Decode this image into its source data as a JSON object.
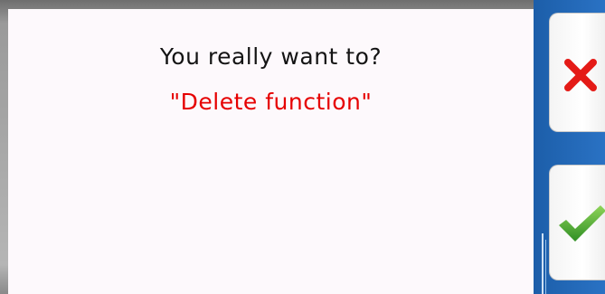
{
  "dialog": {
    "question": "You really want to?",
    "subject": "\"Delete function\""
  },
  "buttons": {
    "cancel_icon": "cross-icon",
    "confirm_icon": "checkmark-icon"
  },
  "colors": {
    "subject_text": "#e60000",
    "question_text": "#141414",
    "sidebar": "#1f64b4",
    "cancel_icon": "#e41b17",
    "confirm_icon": "#3aa62e"
  }
}
